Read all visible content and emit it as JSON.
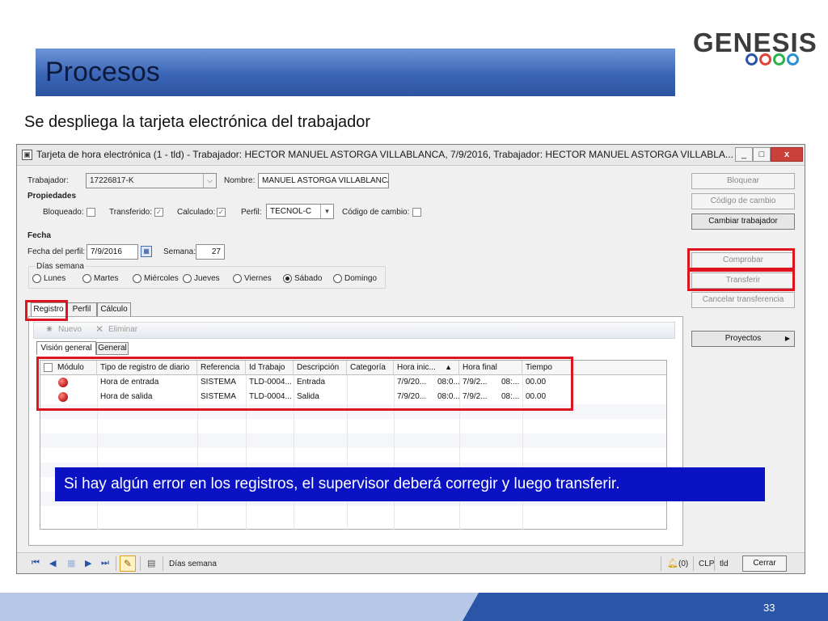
{
  "slide": {
    "title": "Procesos",
    "subtitle": "Se despliega la tarjeta electrónica del trabajador",
    "logo_text": "GENESIS",
    "logo_ring_colors": [
      "#2b56a8",
      "#e4413a",
      "#2bb24c",
      "#2b8fd6"
    ],
    "page_number": "33",
    "banner_text": "Si hay algún error en los registros, el supervisor deberá corregir y luego transferir."
  },
  "window": {
    "title": "Tarjeta de hora electrónica (1 - tld) - Trabajador: HECTOR MANUEL ASTORGA  VILLABLANCA, 7/9/2016, Trabajador: HECTOR MANUEL ASTORGA  VILLABLA...",
    "controls": {
      "minimize": "_",
      "maximize": "□",
      "close": "x"
    }
  },
  "form": {
    "trabajador_label": "Trabajador:",
    "trabajador_value": "17226817-K",
    "nombre_label": "Nombre:",
    "nombre_value": "MANUEL ASTORGA VILLABLANCA",
    "propiedades_label": "Propiedades",
    "bloqueado_label": "Bloqueado:",
    "transferido_label": "Transferido:",
    "calculado_label": "Calculado:",
    "perfil_label": "Perfil:",
    "perfil_value": "TECNOL-C",
    "codigo_cambio_label": "Código de cambio:",
    "fecha_section": "Fecha",
    "fecha_perfil_label": "Fecha del perfil:",
    "fecha_perfil_value": "7/9/2016",
    "semana_label": "Semana:",
    "semana_value": "27",
    "dias_semana_label": "Días semana",
    "dias": [
      "Lunes",
      "Martes",
      "Miércoles",
      "Jueves",
      "Viernes",
      "Sábado",
      "Domingo"
    ],
    "dia_seleccionado": "Sábado",
    "check_mark": "✓"
  },
  "side_buttons": {
    "bloquear": "Bloquear",
    "codigo_cambio": "Código de cambio",
    "cambiar_trabajador": "Cambiar trabajador",
    "comprobar": "Comprobar",
    "transferir": "Transferir",
    "cancelar_transferencia": "Cancelar transferencia",
    "proyectos": "Proyectos"
  },
  "tabs": [
    "Registro",
    "Perfil",
    "Cálculo"
  ],
  "subtabs": [
    "Visión general",
    "General"
  ],
  "toolbar": {
    "nuevo": "Nuevo",
    "eliminar": "Eliminar"
  },
  "grid": {
    "columns": [
      "Módulo",
      "Tipo de registro de diario",
      "Referencia",
      "Id Trabajo",
      "Descripción",
      "Categoría",
      "Hora inic...",
      "Hora final",
      "Tiempo"
    ],
    "rows": [
      {
        "tipo": "Hora de entrada",
        "referencia": "SISTEMA",
        "id_trabajo": "TLD-0004...",
        "descripcion": "Entrada",
        "categoria": "",
        "hora_inicio_fecha": "7/9/20...",
        "hora_inicio_hora": "08:0...",
        "hora_final_fecha": "7/9/2...",
        "hora_final_hora": "08:...",
        "tiempo": "00.00"
      },
      {
        "tipo": "Hora de salida",
        "referencia": "SISTEMA",
        "id_trabajo": "TLD-0004...",
        "descripcion": "Salida",
        "categoria": "",
        "hora_inicio_fecha": "7/9/20...",
        "hora_inicio_hora": "08:0...",
        "hora_final_fecha": "7/9/2...",
        "hora_final_hora": "08:...",
        "tiempo": "00.00"
      }
    ]
  },
  "status": {
    "text": "Días semana",
    "alerts": "(0)",
    "company": "CLP",
    "user": "tld",
    "cerrar": "Cerrar"
  }
}
